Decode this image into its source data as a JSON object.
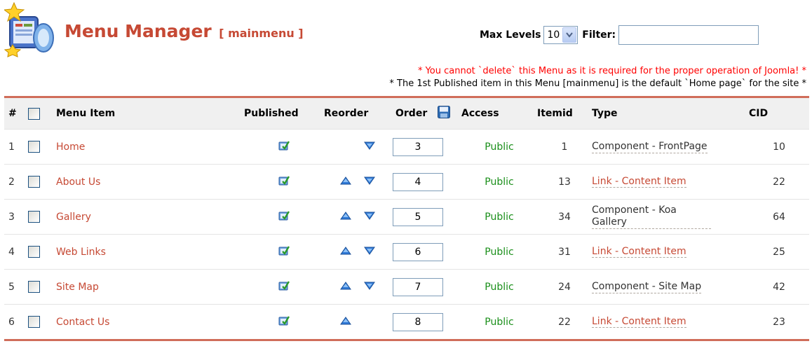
{
  "header": {
    "title": "Menu Manager",
    "subtitle": "[ mainmenu ]",
    "max_levels_label": "Max Levels",
    "max_levels_value": "10",
    "filter_label": "Filter:",
    "filter_value": ""
  },
  "notices": {
    "warning": "* You cannot `delete` this Menu as it is required for the proper operation of Joomla! *",
    "info": "* The 1st Published item in this Menu [mainmenu] is the default `Home page` for the site *"
  },
  "colors": {
    "title": "#c64934",
    "link": "#c64934",
    "access": "#1a8f1a",
    "warning": "#ff0000",
    "rule": "#d06d5a"
  },
  "table": {
    "columns": {
      "num": "#",
      "menu_item": "Menu Item",
      "published": "Published",
      "reorder": "Reorder",
      "order": "Order",
      "access": "Access",
      "itemid": "Itemid",
      "type": "Type",
      "cid": "CID"
    },
    "rows": [
      {
        "num": "1",
        "name": "Home",
        "published": true,
        "up": false,
        "down": true,
        "order": "3",
        "access": "Public",
        "itemid": "1",
        "type": "Component - FrontPage",
        "type_is_link": false,
        "cid": "10"
      },
      {
        "num": "2",
        "name": "About Us",
        "published": true,
        "up": true,
        "down": true,
        "order": "4",
        "access": "Public",
        "itemid": "13",
        "type": "Link - Content Item",
        "type_is_link": true,
        "cid": "22"
      },
      {
        "num": "3",
        "name": "Gallery",
        "published": true,
        "up": true,
        "down": true,
        "order": "5",
        "access": "Public",
        "itemid": "34",
        "type": "Component - Koa Gallery",
        "type_is_link": false,
        "cid": "64"
      },
      {
        "num": "4",
        "name": "Web Links",
        "published": true,
        "up": true,
        "down": true,
        "order": "6",
        "access": "Public",
        "itemid": "31",
        "type": "Link - Content Item",
        "type_is_link": true,
        "cid": "25"
      },
      {
        "num": "5",
        "name": "Site Map",
        "published": true,
        "up": true,
        "down": true,
        "order": "7",
        "access": "Public",
        "itemid": "24",
        "type": "Component - Site Map",
        "type_is_link": false,
        "cid": "42"
      },
      {
        "num": "6",
        "name": "Contact Us",
        "published": true,
        "up": true,
        "down": false,
        "order": "8",
        "access": "Public",
        "itemid": "22",
        "type": "Link - Content Item",
        "type_is_link": true,
        "cid": "23"
      }
    ]
  },
  "icons": {
    "logo": "menu-manager-logo-icon",
    "published": "published-check-icon",
    "up": "move-up-icon",
    "down": "move-down-icon",
    "save_order": "save-order-icon"
  }
}
